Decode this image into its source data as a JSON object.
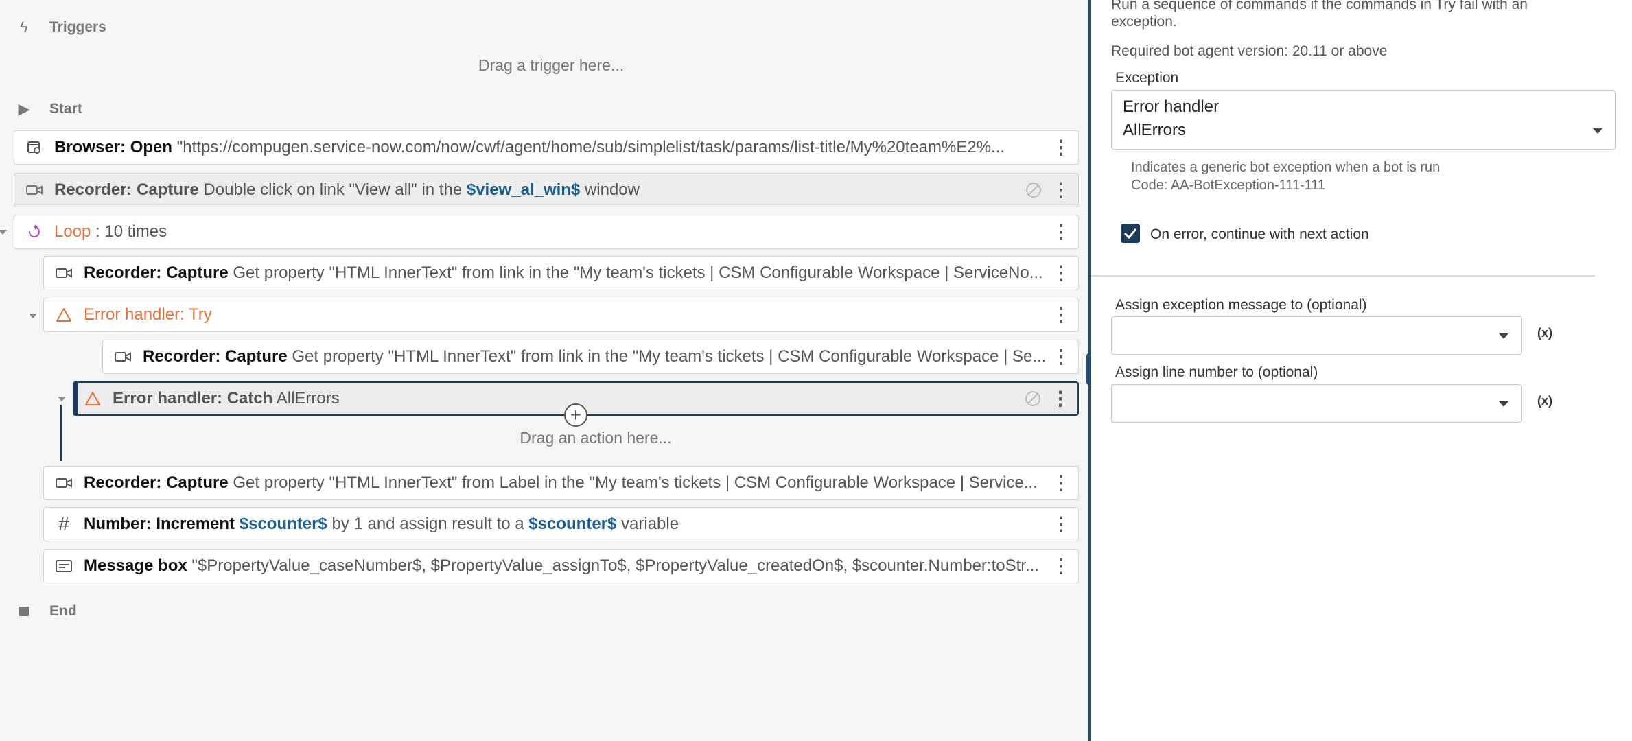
{
  "flow": {
    "triggers_label": "Triggers",
    "trigger_dropzone": "Drag a trigger here...",
    "start_label": "Start",
    "end_label": "End",
    "action_dropzone": "Drag an action here...",
    "actions": [
      {
        "title": "Browser: Open",
        "detail": " \"https://compugen.service-now.com/now/cwf/agent/home/sub/simplelist/task/params/list-title/My%20team%E2%..."
      },
      {
        "title": "Recorder: Capture",
        "detail_a": " Double click on link \"View all\" in the ",
        "var": "$view_al_win$",
        "detail_b": " window"
      },
      {
        "title": "Loop",
        "detail": " : 10 times"
      },
      {
        "title": "Recorder: Capture",
        "detail": " Get property \"HTML InnerText\" from link in the \"My team's tickets | CSM Configurable Workspace | ServiceNo..."
      },
      {
        "title": "Error handler: Try"
      },
      {
        "title": "Recorder: Capture",
        "detail": " Get property \"HTML InnerText\" from link in the \"My team's tickets | CSM Configurable Workspace | Se..."
      },
      {
        "title": "Error handler: Catch",
        "detail": " AllErrors"
      },
      {
        "title": "Recorder: Capture",
        "detail": " Get property \"HTML InnerText\" from Label in the \"My team's tickets | CSM Configurable Workspace | Service..."
      },
      {
        "title": "Number: Increment",
        "var1": "$scounter$",
        "detail_a": " by 1 and assign result to a ",
        "var2": "$scounter$",
        "detail_b": " variable"
      },
      {
        "title": "Message box",
        "detail": " \"$PropertyValue_caseNumber$, $PropertyValue_assignTo$, $PropertyValue_createdOn$, $scounter.Number:toStr..."
      }
    ]
  },
  "panel": {
    "description": "Run a sequence of commands if the commands in Try fail with an exception.",
    "description_line1": "Run a sequence of commands if the commands in Try fail with an",
    "description_line2": "exception.",
    "version": "Required bot agent version: 20.11 or above",
    "exception_label": "Exception",
    "exception_group": "Error handler",
    "exception_value": "AllErrors",
    "exception_help_line1": "Indicates a generic bot exception when a bot is run",
    "exception_help_line2": "Code: AA-BotException-111-111",
    "continue_label": "On error, continue with next action",
    "continue_checked": true,
    "assign_message_label": "Assign exception message to (optional)",
    "assign_line_label": "Assign line number to (optional)",
    "var_button": "(x)"
  },
  "colors": {
    "accent": "#1f3b5a",
    "variable": "#1a5f8f",
    "orange": "#e8703a"
  }
}
